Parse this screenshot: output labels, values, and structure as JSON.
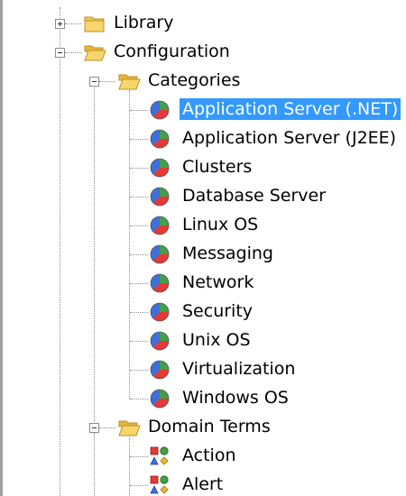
{
  "tree": {
    "library": {
      "label": "Library",
      "expanded": false
    },
    "configuration": {
      "label": "Configuration",
      "expanded": true,
      "categories": {
        "label": "Categories",
        "expanded": true,
        "items": [
          {
            "label": "Application Server (.NET)",
            "selected": true
          },
          {
            "label": "Application Server (J2EE)"
          },
          {
            "label": "Clusters"
          },
          {
            "label": "Database Server"
          },
          {
            "label": "Linux OS"
          },
          {
            "label": "Messaging"
          },
          {
            "label": "Network"
          },
          {
            "label": "Security"
          },
          {
            "label": "Unix OS"
          },
          {
            "label": "Virtualization"
          },
          {
            "label": "Windows OS"
          }
        ]
      },
      "domain_terms": {
        "label": "Domain Terms",
        "expanded": true,
        "items": [
          {
            "label": "Action"
          },
          {
            "label": "Alert"
          }
        ]
      }
    }
  },
  "icons": {
    "folder_closed": "folder-icon",
    "folder_open": "folder-open-icon",
    "category": "pie-chart-icon",
    "domain_term": "shapes-icon"
  },
  "colors": {
    "selection": "#3399ff",
    "folder": "#f2c74e",
    "pie_red": "#e53935",
    "pie_green": "#43a047",
    "pie_blue": "#3f6fd8"
  }
}
